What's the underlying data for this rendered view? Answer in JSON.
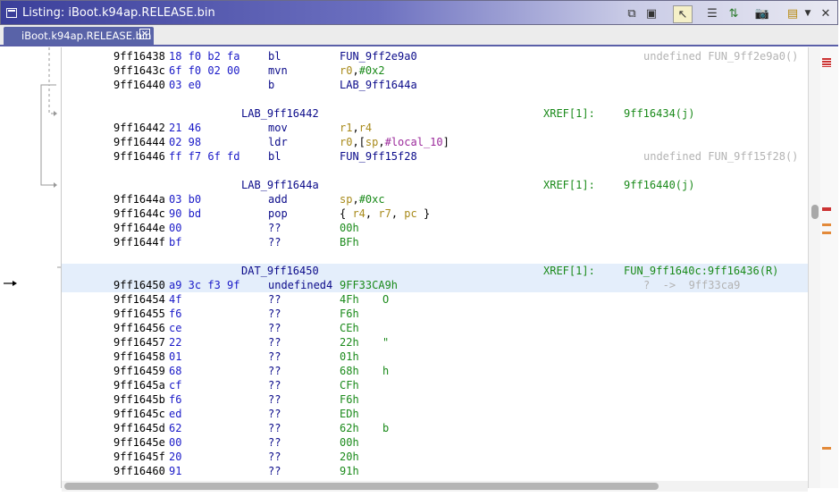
{
  "window": {
    "title": "Listing: iBoot.k94ap.RELEASE.bin"
  },
  "tab": {
    "label": "iBoot.k94ap.RELEASE.bin",
    "close_glyph": "✕"
  },
  "toolbar": {
    "icons": [
      "copy-icon",
      "paste-icon",
      "cursor-highlight-icon",
      "navigation-icon",
      "diff-icon",
      "snapshot-icon",
      "field-config-icon",
      "dropdown-arrow-icon",
      "close-icon"
    ]
  },
  "rows": [
    {
      "addr": "9ff16438",
      "bytes": "18 f0 b2 fa",
      "mnem": "bl",
      "op": "FUN_9ff2e9a0",
      "comment": "undefined FUN_9ff2e9a0()"
    },
    {
      "addr": "9ff1643c",
      "bytes": "6f f0 02 00",
      "mnem": "mvn",
      "op": "r0,#0x2"
    },
    {
      "addr": "9ff16440",
      "bytes": "03 e0",
      "mnem": "b",
      "op": "LAB_9ff1644a"
    },
    {
      "label": "LAB_9ff16442",
      "xref": "XREF[1]:",
      "xref_to": "9ff16434(j)"
    },
    {
      "addr": "9ff16442",
      "bytes": "21 46",
      "mnem": "mov",
      "op": "r1,r4"
    },
    {
      "addr": "9ff16444",
      "bytes": "02 98",
      "mnem": "ldr",
      "op": "r0,[sp,#local_10]"
    },
    {
      "addr": "9ff16446",
      "bytes": "ff f7 6f fd",
      "mnem": "bl",
      "op": "FUN_9ff15f28",
      "comment": "undefined FUN_9ff15f28()"
    },
    {
      "label": "LAB_9ff1644a",
      "xref": "XREF[1]:",
      "xref_to": "9ff16440(j)"
    },
    {
      "addr": "9ff1644a",
      "bytes": "03 b0",
      "mnem": "add",
      "op": "sp,#0xc"
    },
    {
      "addr": "9ff1644c",
      "bytes": "90 bd",
      "mnem": "pop",
      "op": "{ r4, r7, pc }"
    },
    {
      "addr": "9ff1644e",
      "bytes": "00",
      "mnem": "??",
      "op": "00h"
    },
    {
      "addr": "9ff1644f",
      "bytes": "bf",
      "mnem": "??",
      "op": "BFh"
    },
    {
      "label": "DAT_9ff16450",
      "xref": "XREF[1]:",
      "xref_to": "FUN_9ff1640c:9ff16436(R)",
      "hl": true
    },
    {
      "addr": "9ff16450",
      "bytes": "a9 3c f3 9f",
      "mnem": "undefined4",
      "op": "9FF33CA9h",
      "comment": "?  ->  9ff33ca9",
      "hl": true
    },
    {
      "addr": "9ff16454",
      "bytes": "4f",
      "mnem": "??",
      "op": "4Fh",
      "ch": "O"
    },
    {
      "addr": "9ff16455",
      "bytes": "f6",
      "mnem": "??",
      "op": "F6h"
    },
    {
      "addr": "9ff16456",
      "bytes": "ce",
      "mnem": "??",
      "op": "CEh"
    },
    {
      "addr": "9ff16457",
      "bytes": "22",
      "mnem": "??",
      "op": "22h",
      "ch": "\""
    },
    {
      "addr": "9ff16458",
      "bytes": "01",
      "mnem": "??",
      "op": "01h"
    },
    {
      "addr": "9ff16459",
      "bytes": "68",
      "mnem": "??",
      "op": "68h",
      "ch": "h"
    },
    {
      "addr": "9ff1645a",
      "bytes": "cf",
      "mnem": "??",
      "op": "CFh"
    },
    {
      "addr": "9ff1645b",
      "bytes": "f6",
      "mnem": "??",
      "op": "F6h"
    },
    {
      "addr": "9ff1645c",
      "bytes": "ed",
      "mnem": "??",
      "op": "EDh"
    },
    {
      "addr": "9ff1645d",
      "bytes": "62",
      "mnem": "??",
      "op": "62h",
      "ch": "b"
    },
    {
      "addr": "9ff1645e",
      "bytes": "00",
      "mnem": "??",
      "op": "00h"
    },
    {
      "addr": "9ff1645f",
      "bytes": "20",
      "mnem": "??",
      "op": "20h"
    },
    {
      "addr": "9ff16460",
      "bytes": "91",
      "mnem": "??",
      "op": "91h"
    }
  ],
  "colors": {
    "title_gradient_start": "#3b3f9a",
    "tab_bg": "#5963a8",
    "address": "#000000",
    "bytes": "#1a1ac8",
    "mnemonic": "#0b0b8a",
    "xref": "#1a8a1a",
    "comment": "#b3b3b3",
    "register": "#a88a1a",
    "highlight": "#e4eefb"
  }
}
